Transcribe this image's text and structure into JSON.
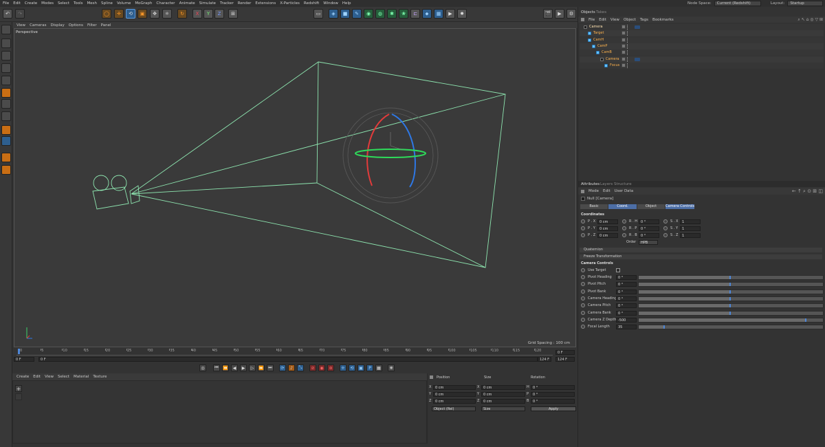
{
  "menu": [
    "File",
    "Edit",
    "Create",
    "Modes",
    "Select",
    "Tools",
    "Mesh",
    "Spline",
    "Volume",
    "MoGraph",
    "Character",
    "Animate",
    "Simulate",
    "Tracker",
    "Render",
    "Extensions",
    "X-Particles",
    "Redshift",
    "Window",
    "Help"
  ],
  "top_right": {
    "node_space_label": "Node Space:",
    "node_space_value": "Current (Redshift)",
    "layout_label": "Layout:",
    "layout_value": "Startup"
  },
  "viewport_menu": [
    "View",
    "Cameras",
    "Display",
    "Options",
    "Filter",
    "Panel"
  ],
  "viewport": {
    "label": "Perspective",
    "grid_spacing": "Grid Spacing : 100 cm"
  },
  "timeline": {
    "ticks": [
      "0",
      "5",
      "10",
      "15",
      "20",
      "25",
      "30",
      "35",
      "40",
      "45",
      "50",
      "55",
      "60",
      "65",
      "70",
      "75",
      "80",
      "85",
      "90",
      "95",
      "100",
      "105",
      "110",
      "115",
      "120"
    ],
    "current_frame": "0 F",
    "start": "0 F",
    "preview_start": "0 F",
    "preview_end": "124 F",
    "end": "124 F",
    "end_label": "0 F"
  },
  "material_menu": [
    "Create",
    "Edit",
    "View",
    "Select",
    "Material",
    "Texture"
  ],
  "coord_panel": {
    "headers": [
      "Position",
      "Size",
      "Rotation"
    ],
    "rows": [
      {
        "axis": "X",
        "pos": "0 cm",
        "size_axis": "X",
        "size": "0 cm",
        "rot_axis": "H",
        "rot": "0 °"
      },
      {
        "axis": "Y",
        "pos": "0 cm",
        "size_axis": "Y",
        "size": "0 cm",
        "rot_axis": "P",
        "rot": "0 °"
      },
      {
        "axis": "Z",
        "pos": "0 cm",
        "size_axis": "Z",
        "size": "0 cm",
        "rot_axis": "B",
        "rot": "0 °"
      }
    ],
    "mode_select": "Object (Rel)",
    "size_select": "Size",
    "apply": "Apply"
  },
  "objects_tabs": [
    "Objects",
    "Takes"
  ],
  "objects_menu": [
    "File",
    "Edit",
    "View",
    "Object",
    "Tags",
    "Bookmarks"
  ],
  "objects": [
    {
      "name": "Camera",
      "indent": 0,
      "kind": "cam"
    },
    {
      "name": "Target",
      "indent": 1,
      "kind": "null"
    },
    {
      "name": "CamH",
      "indent": 1,
      "kind": "null"
    },
    {
      "name": "CamP",
      "indent": 2,
      "kind": "null"
    },
    {
      "name": "CamB",
      "indent": 3,
      "kind": "null"
    },
    {
      "name": "Camera",
      "indent": 4,
      "kind": "cam"
    },
    {
      "name": "Focus",
      "indent": 5,
      "kind": "null"
    }
  ],
  "attr_tabs": [
    "Attributes",
    "Layers",
    "Structure"
  ],
  "attr_menu": [
    "Mode",
    "Edit",
    "User Data"
  ],
  "attr_title": "Null [Camera]",
  "attr_buttons": [
    {
      "label": "Basic",
      "active": false
    },
    {
      "label": "Coord.",
      "active": true
    },
    {
      "label": "Object",
      "active": false
    },
    {
      "label": "Camera Controls",
      "active": true
    }
  ],
  "coordinates": {
    "title": "Coordinates",
    "rows": [
      {
        "p_label": "P . X",
        "p": "0 cm",
        "r_label": "R . H",
        "r": "0 °",
        "s_label": "S . X",
        "s": "1"
      },
      {
        "p_label": "P . Y",
        "p": "0 cm",
        "r_label": "R . P",
        "r": "0 °",
        "s_label": "S . Y",
        "s": "1"
      },
      {
        "p_label": "P . Z",
        "p": "0 cm",
        "r_label": "R . B",
        "r": "0 °",
        "s_label": "S . Z",
        "s": "1"
      }
    ],
    "order_label": "Order",
    "order_value": "HPB"
  },
  "sections": [
    "Quaternion",
    "Freeze Transformation"
  ],
  "camera_controls": {
    "title": "Camera Controls",
    "use_target": "Use Target",
    "params": [
      {
        "label": "Pivot Heading",
        "value": "0 °",
        "fill": 0.5
      },
      {
        "label": "Pivot Pitch",
        "value": "0 °",
        "fill": 0.5
      },
      {
        "label": "Pivot Bank",
        "value": "0 °",
        "fill": 0.5
      },
      {
        "label": "Camera Heading",
        "value": "0 °",
        "fill": 0.5
      },
      {
        "label": "Camera Pitch",
        "value": "0 °",
        "fill": 0.5
      },
      {
        "label": "Camera Bank",
        "value": "0 °",
        "fill": 0.5
      },
      {
        "label": "Camera Z Depth",
        "value": "-500",
        "fill": 0.91
      },
      {
        "label": "Focal Length",
        "value": "35",
        "fill": 0.14
      }
    ]
  }
}
